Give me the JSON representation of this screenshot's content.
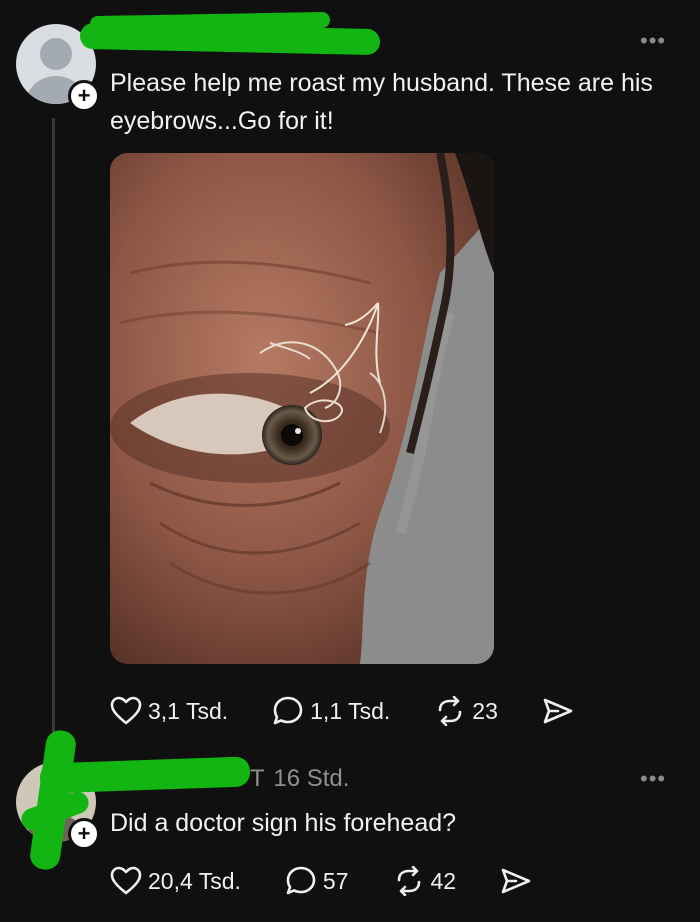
{
  "post": {
    "text": "Please help me roast my husband.  These are his eyebrows...Go for it!",
    "more_label": "•••",
    "follow_label": "+",
    "image_alt": "Close-up photo of an eye and eyebrow",
    "likes": "3,1 Tsd.",
    "comments": "1,1 Tsd.",
    "reposts": "23"
  },
  "reply": {
    "time": "16 Std.",
    "username_partial": "T",
    "text": "Did a doctor sign his forehead?",
    "more_label": "•••",
    "follow_label": "+",
    "likes": "20,4 Tsd.",
    "comments": "57",
    "reposts": "42"
  },
  "colors": {
    "background": "#101010",
    "redaction": "#12b512",
    "text": "#f2f2f2",
    "muted": "#8f8f8f"
  }
}
